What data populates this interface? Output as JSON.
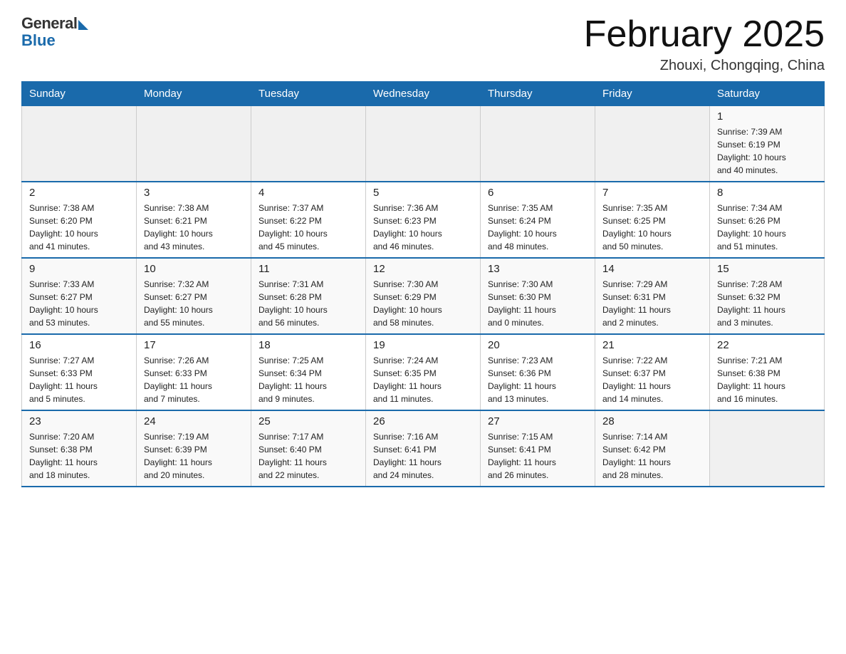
{
  "logo": {
    "general": "General",
    "blue": "Blue"
  },
  "title": "February 2025",
  "location": "Zhouxi, Chongqing, China",
  "days_of_week": [
    "Sunday",
    "Monday",
    "Tuesday",
    "Wednesday",
    "Thursday",
    "Friday",
    "Saturday"
  ],
  "weeks": [
    [
      {
        "day": "",
        "info": ""
      },
      {
        "day": "",
        "info": ""
      },
      {
        "day": "",
        "info": ""
      },
      {
        "day": "",
        "info": ""
      },
      {
        "day": "",
        "info": ""
      },
      {
        "day": "",
        "info": ""
      },
      {
        "day": "1",
        "info": "Sunrise: 7:39 AM\nSunset: 6:19 PM\nDaylight: 10 hours\nand 40 minutes."
      }
    ],
    [
      {
        "day": "2",
        "info": "Sunrise: 7:38 AM\nSunset: 6:20 PM\nDaylight: 10 hours\nand 41 minutes."
      },
      {
        "day": "3",
        "info": "Sunrise: 7:38 AM\nSunset: 6:21 PM\nDaylight: 10 hours\nand 43 minutes."
      },
      {
        "day": "4",
        "info": "Sunrise: 7:37 AM\nSunset: 6:22 PM\nDaylight: 10 hours\nand 45 minutes."
      },
      {
        "day": "5",
        "info": "Sunrise: 7:36 AM\nSunset: 6:23 PM\nDaylight: 10 hours\nand 46 minutes."
      },
      {
        "day": "6",
        "info": "Sunrise: 7:35 AM\nSunset: 6:24 PM\nDaylight: 10 hours\nand 48 minutes."
      },
      {
        "day": "7",
        "info": "Sunrise: 7:35 AM\nSunset: 6:25 PM\nDaylight: 10 hours\nand 50 minutes."
      },
      {
        "day": "8",
        "info": "Sunrise: 7:34 AM\nSunset: 6:26 PM\nDaylight: 10 hours\nand 51 minutes."
      }
    ],
    [
      {
        "day": "9",
        "info": "Sunrise: 7:33 AM\nSunset: 6:27 PM\nDaylight: 10 hours\nand 53 minutes."
      },
      {
        "day": "10",
        "info": "Sunrise: 7:32 AM\nSunset: 6:27 PM\nDaylight: 10 hours\nand 55 minutes."
      },
      {
        "day": "11",
        "info": "Sunrise: 7:31 AM\nSunset: 6:28 PM\nDaylight: 10 hours\nand 56 minutes."
      },
      {
        "day": "12",
        "info": "Sunrise: 7:30 AM\nSunset: 6:29 PM\nDaylight: 10 hours\nand 58 minutes."
      },
      {
        "day": "13",
        "info": "Sunrise: 7:30 AM\nSunset: 6:30 PM\nDaylight: 11 hours\nand 0 minutes."
      },
      {
        "day": "14",
        "info": "Sunrise: 7:29 AM\nSunset: 6:31 PM\nDaylight: 11 hours\nand 2 minutes."
      },
      {
        "day": "15",
        "info": "Sunrise: 7:28 AM\nSunset: 6:32 PM\nDaylight: 11 hours\nand 3 minutes."
      }
    ],
    [
      {
        "day": "16",
        "info": "Sunrise: 7:27 AM\nSunset: 6:33 PM\nDaylight: 11 hours\nand 5 minutes."
      },
      {
        "day": "17",
        "info": "Sunrise: 7:26 AM\nSunset: 6:33 PM\nDaylight: 11 hours\nand 7 minutes."
      },
      {
        "day": "18",
        "info": "Sunrise: 7:25 AM\nSunset: 6:34 PM\nDaylight: 11 hours\nand 9 minutes."
      },
      {
        "day": "19",
        "info": "Sunrise: 7:24 AM\nSunset: 6:35 PM\nDaylight: 11 hours\nand 11 minutes."
      },
      {
        "day": "20",
        "info": "Sunrise: 7:23 AM\nSunset: 6:36 PM\nDaylight: 11 hours\nand 13 minutes."
      },
      {
        "day": "21",
        "info": "Sunrise: 7:22 AM\nSunset: 6:37 PM\nDaylight: 11 hours\nand 14 minutes."
      },
      {
        "day": "22",
        "info": "Sunrise: 7:21 AM\nSunset: 6:38 PM\nDaylight: 11 hours\nand 16 minutes."
      }
    ],
    [
      {
        "day": "23",
        "info": "Sunrise: 7:20 AM\nSunset: 6:38 PM\nDaylight: 11 hours\nand 18 minutes."
      },
      {
        "day": "24",
        "info": "Sunrise: 7:19 AM\nSunset: 6:39 PM\nDaylight: 11 hours\nand 20 minutes."
      },
      {
        "day": "25",
        "info": "Sunrise: 7:17 AM\nSunset: 6:40 PM\nDaylight: 11 hours\nand 22 minutes."
      },
      {
        "day": "26",
        "info": "Sunrise: 7:16 AM\nSunset: 6:41 PM\nDaylight: 11 hours\nand 24 minutes."
      },
      {
        "day": "27",
        "info": "Sunrise: 7:15 AM\nSunset: 6:41 PM\nDaylight: 11 hours\nand 26 minutes."
      },
      {
        "day": "28",
        "info": "Sunrise: 7:14 AM\nSunset: 6:42 PM\nDaylight: 11 hours\nand 28 minutes."
      },
      {
        "day": "",
        "info": ""
      }
    ]
  ]
}
